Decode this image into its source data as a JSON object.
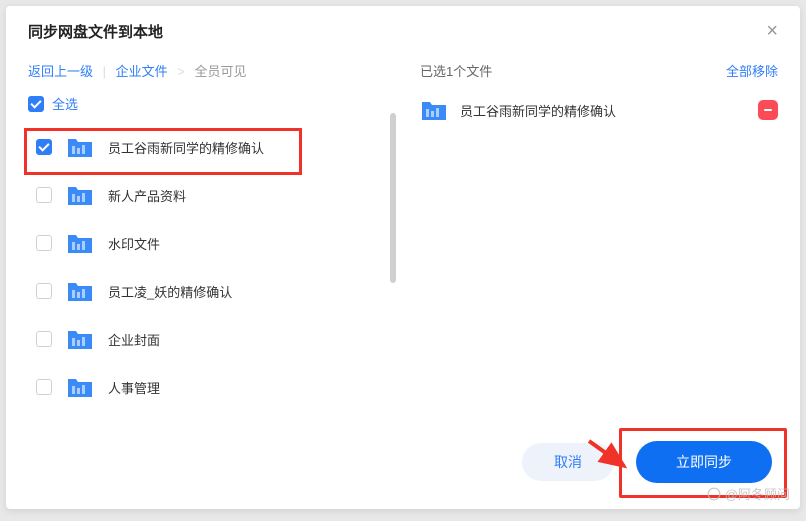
{
  "header": {
    "title": "同步网盘文件到本地"
  },
  "breadcrumb": {
    "back": "返回上一级",
    "root": "企业文件",
    "current": "全员可见"
  },
  "selectAll": "全选",
  "files": [
    {
      "name": "员工谷雨新同学的精修确认",
      "checked": true
    },
    {
      "name": "新人产品资料",
      "checked": false
    },
    {
      "name": "水印文件",
      "checked": false
    },
    {
      "name": "员工凌_妖的精修确认",
      "checked": false
    },
    {
      "name": "企业封面",
      "checked": false
    },
    {
      "name": "人事管理",
      "checked": false
    }
  ],
  "right": {
    "count": "已选1个文件",
    "removeAll": "全部移除",
    "selected": [
      {
        "name": "员工谷雨新同学的精修确认"
      }
    ]
  },
  "footer": {
    "cancel": "取消",
    "confirm": "立即同步"
  },
  "watermark": "@阿冬顾问"
}
